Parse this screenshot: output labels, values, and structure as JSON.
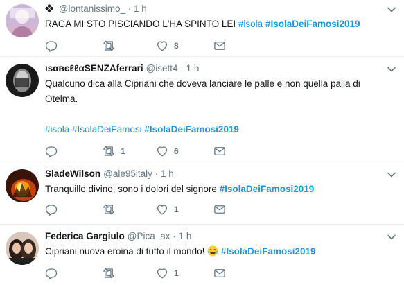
{
  "colors": {
    "link": "#1b95e0",
    "meta": "#657786",
    "text": "#14171a",
    "divider": "#e6ecf0"
  },
  "tweets": [
    {
      "name": "",
      "name_icon": "flower-icon",
      "handle": "@lontanissimo_",
      "dot": "·",
      "time": "1 h",
      "lines": [
        "RAGA MI STO PISCIANDO L'HA SPINTO LEI "
      ],
      "tags": [
        "#isola",
        "#IsolaDeiFamosi2019"
      ],
      "reply_count": "",
      "retweet_count": "",
      "like_count": "8"
    },
    {
      "name": "ıѕαвєℓℓαSENZAferrari",
      "handle": "@isett4",
      "dot": "·",
      "time": "1 h",
      "line1": "Qualcuno dica alla Cipriani che doveva lanciare le palle e non quella palla di",
      "line2": "Otelma.",
      "tags": [
        "#isola",
        "#IsolaDeiFamosi",
        "#IsolaDeiFamosi2019"
      ],
      "reply_count": "",
      "retweet_count": "1",
      "like_count": "6"
    },
    {
      "name": "SladeWilson",
      "handle": "@ale95italy",
      "dot": "·",
      "time": "1 h",
      "text": "Tranquillo divino, sono i dolori del signore ",
      "tag": "#IsolaDeiFamosi2019",
      "reply_count": "",
      "retweet_count": "",
      "like_count": "1"
    },
    {
      "name": "Federica Gargiulo",
      "handle": "@Pica_ax",
      "dot": "·",
      "time": "1 h",
      "text": "Cipriani nuova eroina di tutto il mondo! ",
      "emoji": "laughing-crying-emoji",
      "tag": "#IsolaDeiFamosi2019",
      "reply_count": "",
      "retweet_count": "",
      "like_count": "1"
    }
  ]
}
